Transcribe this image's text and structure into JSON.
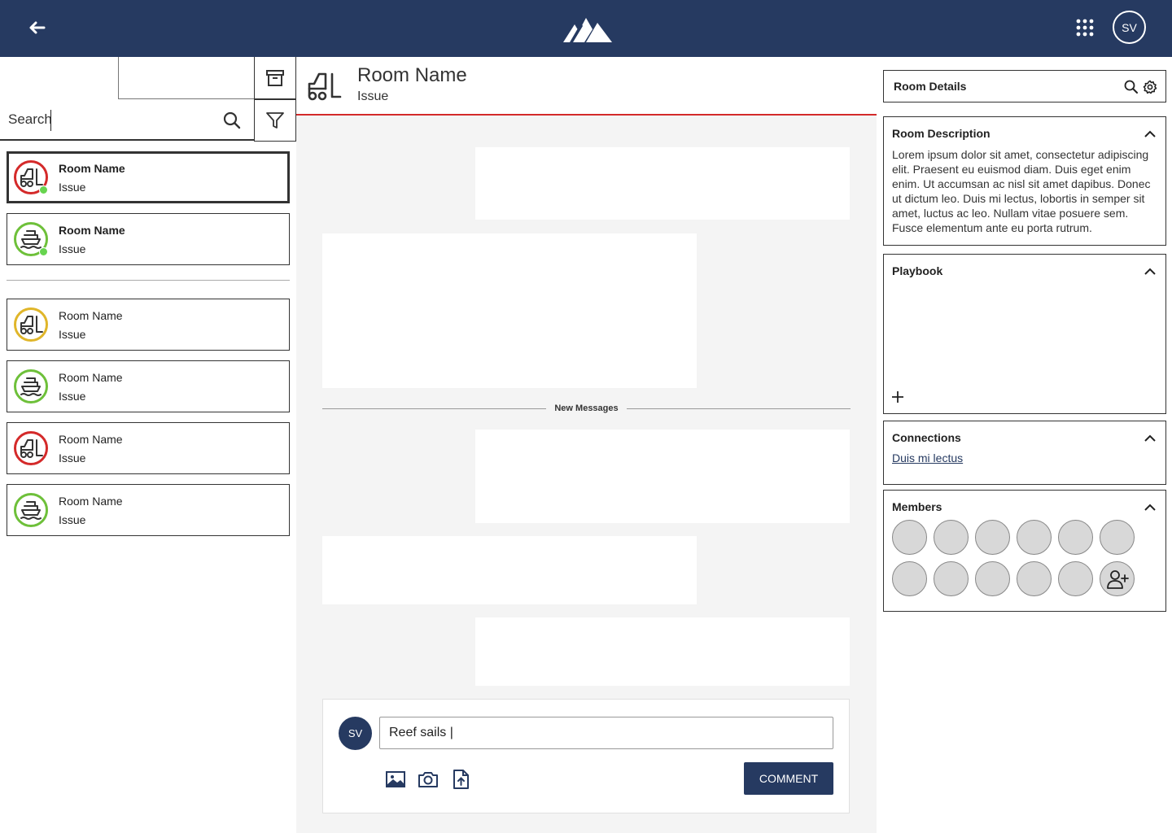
{
  "topbar": {
    "avatar_initials": "SV"
  },
  "left": {
    "search": {
      "placeholder": "Search"
    },
    "rooms_top": [
      {
        "name": "Room Name",
        "issue": "Issue",
        "ring_color": "#d42a2a",
        "icon": "forklift-icon",
        "unread": true,
        "active": true
      },
      {
        "name": "Room Name",
        "issue": "Issue",
        "ring_color": "#6ec03a",
        "icon": "ship-icon",
        "unread": true,
        "active": false
      }
    ],
    "rooms_bottom": [
      {
        "name": "Room Name",
        "issue": "Issue",
        "ring_color": "#e0b62a",
        "icon": "forklift-icon"
      },
      {
        "name": "Room Name",
        "issue": "Issue",
        "ring_color": "#6ec03a",
        "icon": "ship-icon"
      },
      {
        "name": "Room Name",
        "issue": "Issue",
        "ring_color": "#d42a2a",
        "icon": "forklift-icon"
      },
      {
        "name": "Room Name",
        "issue": "Issue",
        "ring_color": "#6ec03a",
        "icon": "ship-icon"
      }
    ]
  },
  "center": {
    "header": {
      "title": "Room Name",
      "subtitle": "Issue",
      "accent": "#d42a2a"
    },
    "new_messages_label": "New Messages",
    "composer": {
      "avatar_initials": "SV",
      "input_value": "Reef sails |",
      "comment_label": "COMMENT"
    }
  },
  "right": {
    "details_title": "Room Details",
    "description": {
      "title": "Room Description",
      "text": "Lorem ipsum dolor sit amet, consectetur adipiscing elit. Praesent eu euismod diam. Duis eget enim enim. Ut accumsan ac nisl sit amet dapibus. Donec ut dictum leo. Duis mi lectus, lobortis in semper sit amet, luctus ac leo. Nullam vitae posuere sem. Fusce elementum ante eu porta rutrum."
    },
    "playbook": {
      "title": "Playbook"
    },
    "connections": {
      "title": "Connections",
      "link": "Duis mi lectus"
    },
    "members": {
      "title": "Members"
    }
  },
  "colors": {
    "brand": "#263a61",
    "red": "#d42a2a",
    "green": "#6ec03a",
    "yellow": "#e0b62a",
    "online": "#67d44f"
  }
}
